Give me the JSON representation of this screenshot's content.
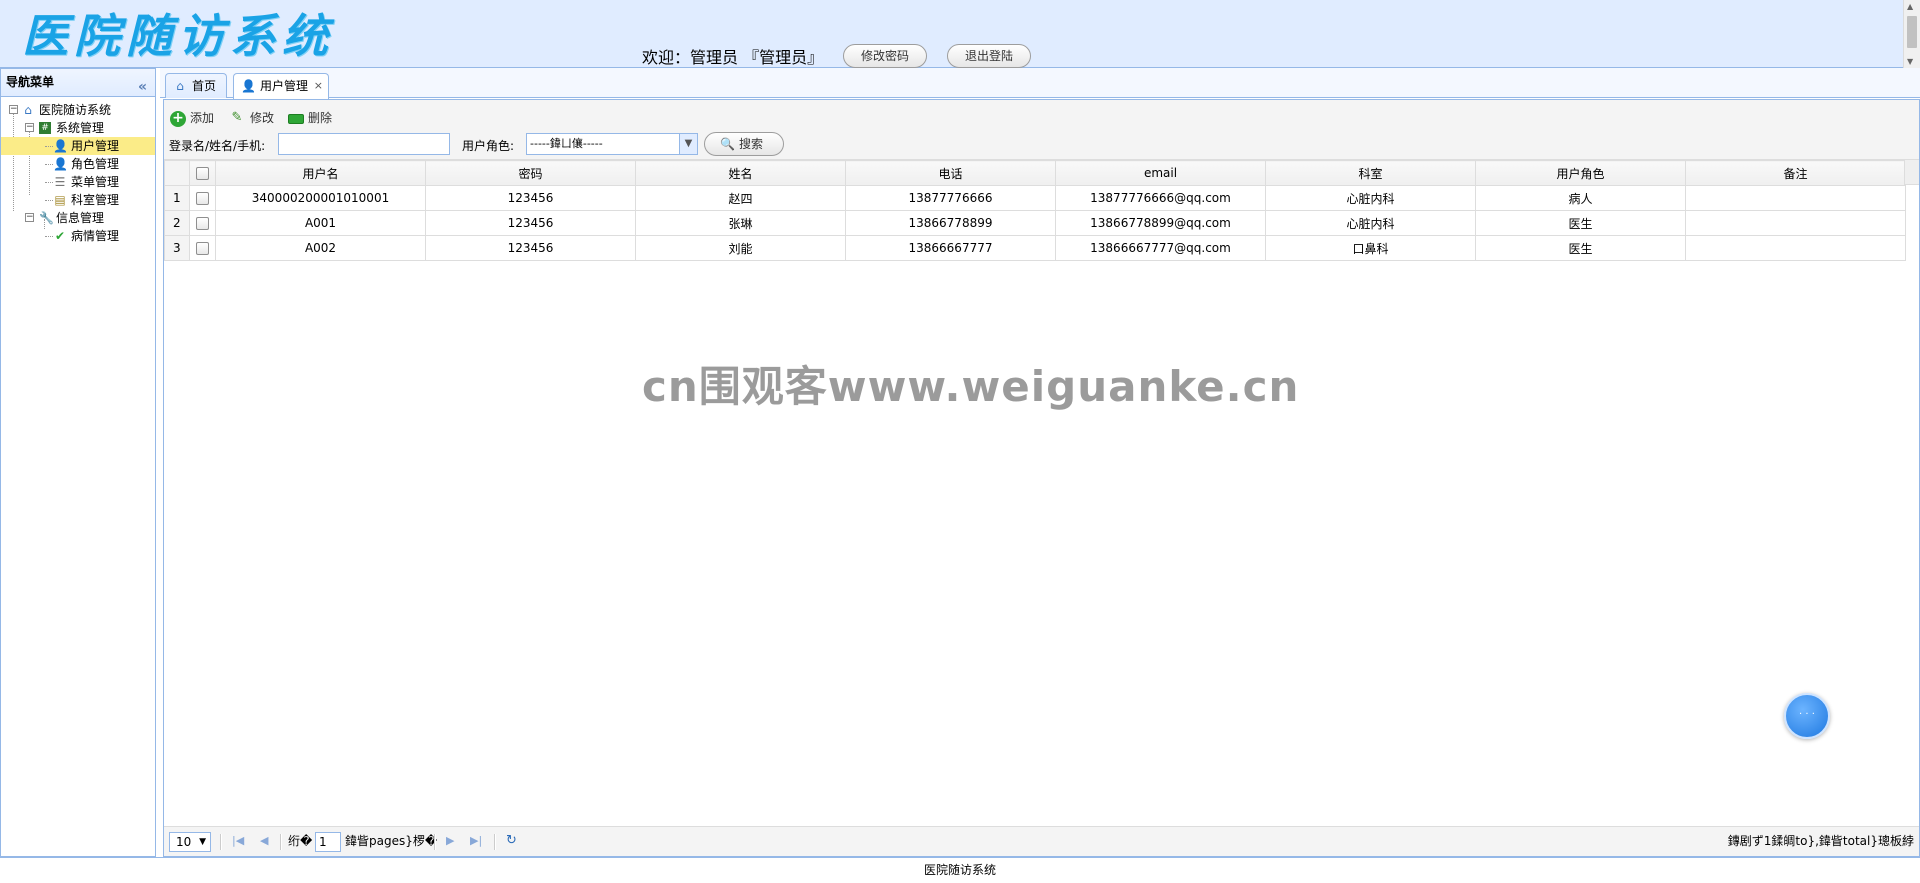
{
  "header": {
    "logo_text": "医院随访系统",
    "welcome_text": "欢迎：管理员 『管理员』",
    "change_password_label": "修改密码",
    "logout_label": "退出登陆"
  },
  "west": {
    "title": "导航菜单",
    "tree": {
      "root": "医院随访系统",
      "system_mgmt": "系统管理",
      "user_mgmt": "用户管理",
      "role_mgmt": "角色管理",
      "menu_mgmt": "菜单管理",
      "dept_mgmt": "科室管理",
      "info_mgmt": "信息管理",
      "condition_mgmt": "病情管理"
    }
  },
  "tabs": [
    {
      "label": "首页"
    },
    {
      "label": "用户管理",
      "close": "×"
    }
  ],
  "toolbar": {
    "add_label": "添加",
    "edit_label": "修改",
    "delete_label": "删除",
    "search_label": "登录名/姓名/手机:",
    "search_value": "",
    "role_label": "用户角色:",
    "role_selected": "-----鍏ㄩ儴-----",
    "search_button": "搜索"
  },
  "grid": {
    "columns": [
      "用户名",
      "密码",
      "姓名",
      "电话",
      "email",
      "科室",
      "用户角色",
      "备注"
    ],
    "rows": [
      {
        "num": "1",
        "username": "340000200001010001",
        "password": "123456",
        "name": "赵四",
        "phone": "13877776666",
        "email": "13877776666@qq.com",
        "dept": "心脏内科",
        "role": "病人",
        "note": ""
      },
      {
        "num": "2",
        "username": "A001",
        "password": "123456",
        "name": "张琳",
        "phone": "13866778899",
        "email": "13866778899@qq.com",
        "dept": "心脏内科",
        "role": "医生",
        "note": ""
      },
      {
        "num": "3",
        "username": "A002",
        "password": "123456",
        "name": "刘能",
        "phone": "13866667777",
        "email": "13866667777@qq.com",
        "dept": "口鼻科",
        "role": "医生",
        "note": ""
      }
    ]
  },
  "watermark": "cn围观客www.weiguanke.cn",
  "pager": {
    "page_size": "10",
    "before_page": "绗�",
    "page_number": "1",
    "after_page": "鍏眥pages}椤�",
    "info": "鏄剧ず1鍒皗to},鍏眥total}璁板綍"
  },
  "footer": {
    "text": "医院随访系统"
  }
}
